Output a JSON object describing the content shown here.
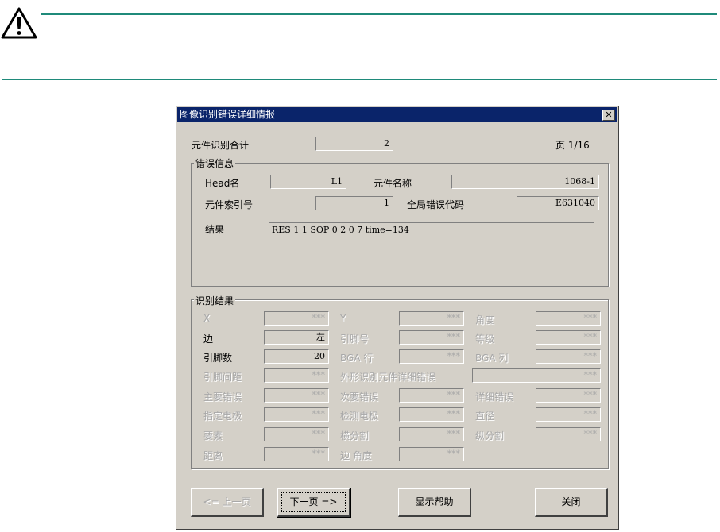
{
  "dialog": {
    "title": "图像识别错误详细情报",
    "close_label": "✕",
    "total_label": "元件识别合计",
    "total_value": "2",
    "page_label": "页 1/16"
  },
  "error_info": {
    "group_title": "错误信息",
    "head_label": "Head名",
    "head_value": "L1",
    "part_name_label": "元件名称",
    "part_name_value": "1068-1",
    "index_label": "元件索引号",
    "index_value": "1",
    "global_code_label": "全局错误代码",
    "global_code_value": "E631040",
    "result_label": "结果",
    "result_value": "RES 1 1 SOP 0 2 0 7 time=134"
  },
  "recog": {
    "group_title": "识别结果",
    "fields": [
      {
        "label": "X",
        "value": "***",
        "enabled": false
      },
      {
        "label": "Y",
        "value": "***",
        "enabled": false
      },
      {
        "label": "角度",
        "value": "***",
        "enabled": false
      },
      {
        "label": "边",
        "value": "左",
        "enabled": true
      },
      {
        "label": "引脚号",
        "value": "***",
        "enabled": false
      },
      {
        "label": "等级",
        "value": "***",
        "enabled": false
      },
      {
        "label": "引脚数",
        "value": "20",
        "enabled": true
      },
      {
        "label": "BGA 行",
        "value": "***",
        "enabled": false
      },
      {
        "label": "BGA 列",
        "value": "***",
        "enabled": false
      },
      {
        "label": "引脚间距",
        "value": "***",
        "enabled": false
      },
      {
        "label": "外形识别元件详细错误",
        "value": "***",
        "enabled": false
      },
      {
        "label": "主要错误",
        "value": "***",
        "enabled": false
      },
      {
        "label": "次要错误",
        "value": "***",
        "enabled": false
      },
      {
        "label": "详细错误",
        "value": "***",
        "enabled": false
      },
      {
        "label": "指定电极",
        "value": "***",
        "enabled": false
      },
      {
        "label": "检测电极",
        "value": "***",
        "enabled": false
      },
      {
        "label": "直径",
        "value": "***",
        "enabled": false
      },
      {
        "label": "要素",
        "value": "***",
        "enabled": false
      },
      {
        "label": "横分割",
        "value": "***",
        "enabled": false
      },
      {
        "label": "纵分割",
        "value": "***",
        "enabled": false
      },
      {
        "label": "距离",
        "value": "***",
        "enabled": false
      },
      {
        "label": "边 角度",
        "value": "***",
        "enabled": false
      }
    ]
  },
  "buttons": {
    "prev": "<= 上一页",
    "next": "下一页 =>",
    "help": "显示帮助",
    "close": "关闭"
  },
  "icons": {
    "warning": "warning-triangle-icon"
  }
}
